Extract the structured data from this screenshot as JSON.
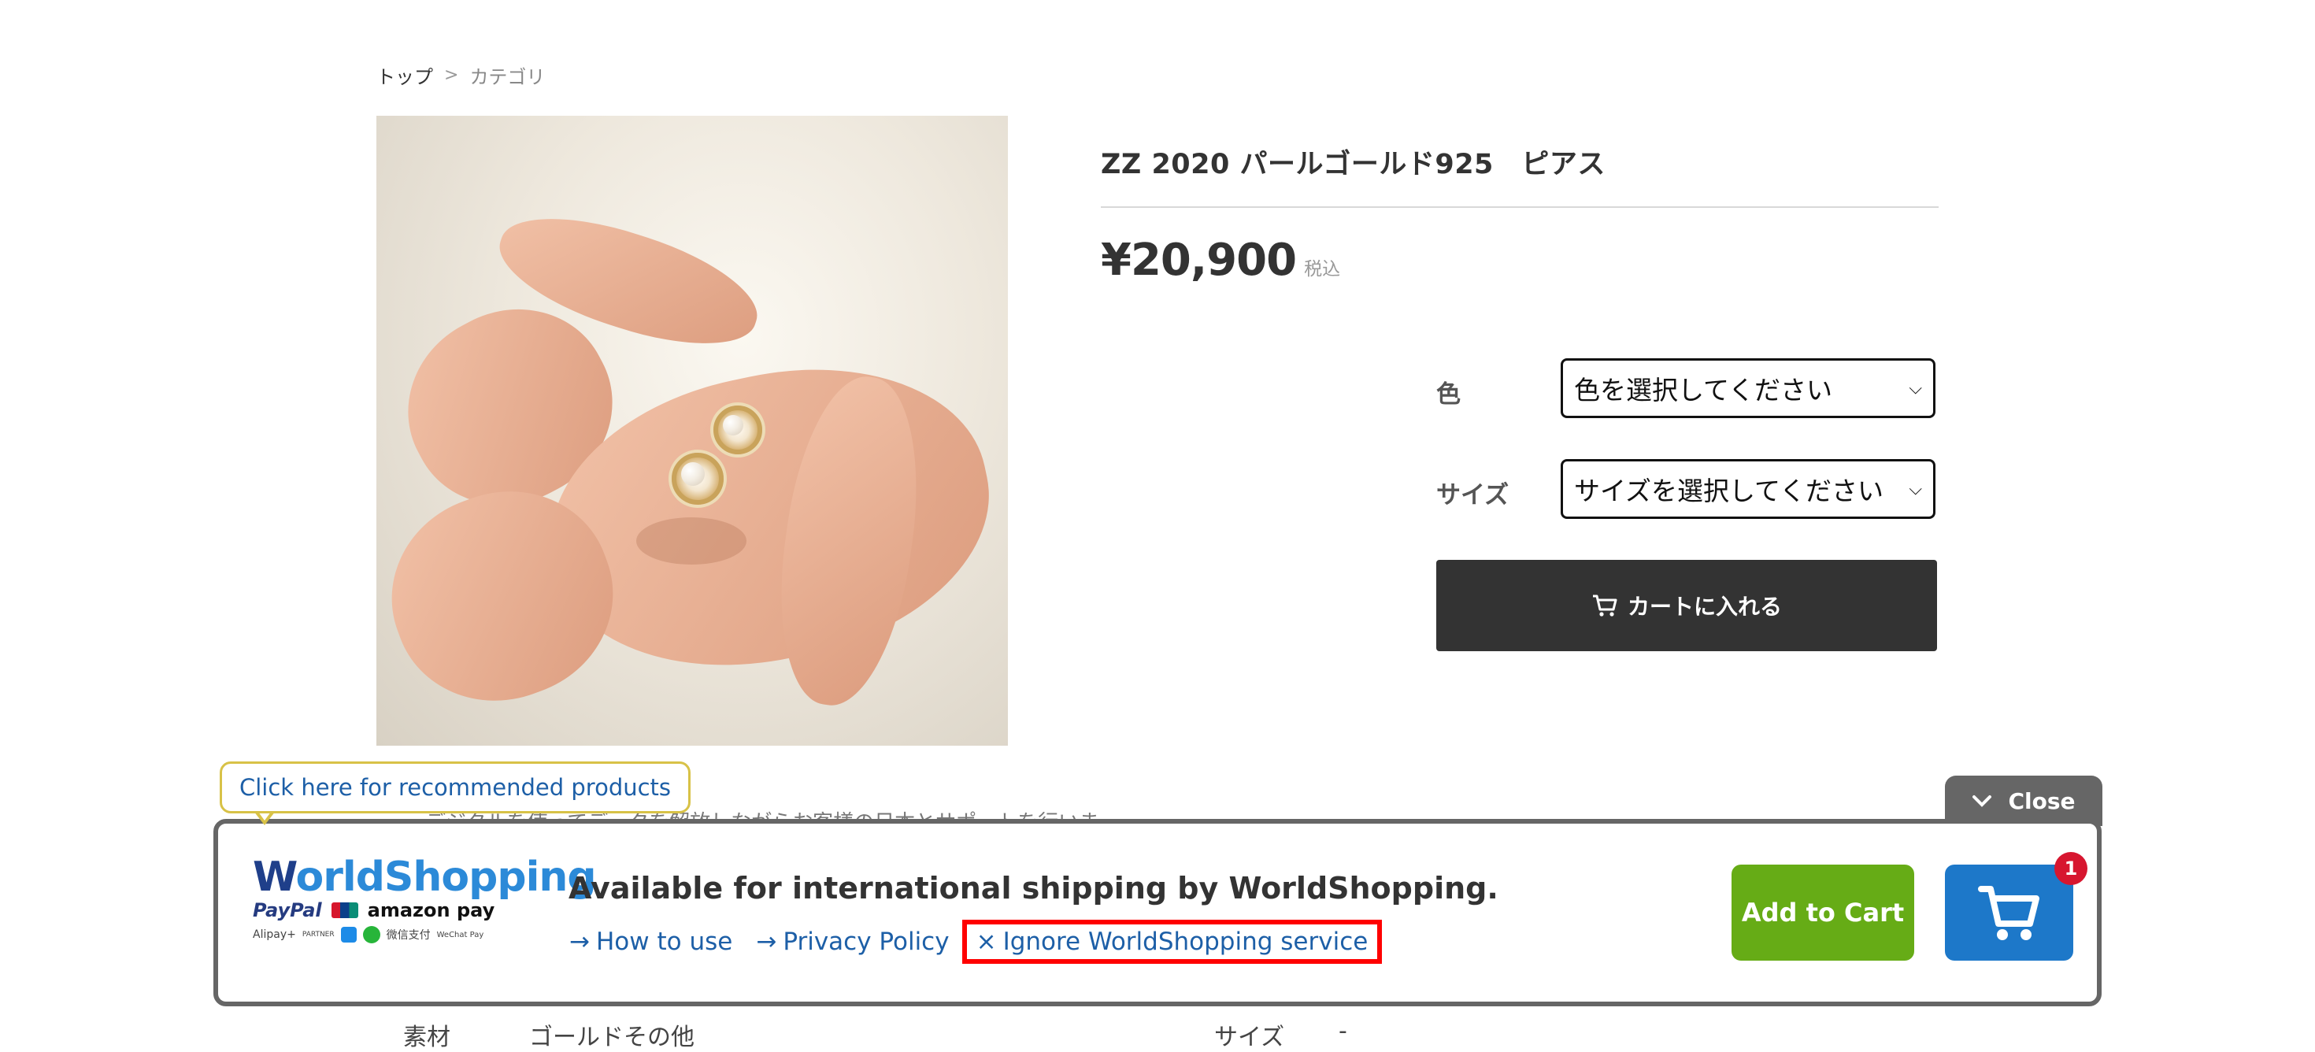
{
  "breadcrumb": {
    "home": "トップ",
    "separator": ">",
    "current": "カテゴリ"
  },
  "product": {
    "title": "ZZ 2020 パールゴールド925　ピアス",
    "price": "¥20,900",
    "tax_label": "税込",
    "image_alt": "hands holding pearl gold earrings"
  },
  "options": {
    "color_label": "色",
    "color_select": "色を選択してください",
    "size_label": "サイズ",
    "size_select": "サイズを選択してください"
  },
  "cart_button": {
    "label": "カートに入れる",
    "icon": "cart-icon"
  },
  "background_text": {
    "description_partial": "デジタルを使ってデータを解放しながらお客様の日本とサポートを行いま",
    "spec_material_label": "素材",
    "spec_material_value": "ゴールドその他",
    "spec_size_label": "サイズ",
    "spec_size_value": "-"
  },
  "worldshopping": {
    "logo_text_w": "W",
    "logo_text_rest": "orldShopping",
    "payment_row1": [
      "PayPal",
      "amazon pay"
    ],
    "payment_row2": [
      "Alipay+",
      "PARTNER",
      "微信支付",
      "WeChat Pay"
    ],
    "heading": "Available for international shipping by WorldShopping.",
    "links": {
      "how_to_use": "How to use",
      "privacy_policy": "Privacy Policy",
      "ignore": "Ignore WorldShopping service"
    },
    "add_to_cart": "Add to Cart",
    "cart_count": "1",
    "close_label": "Close",
    "tooltip": "Click here for recommended products"
  },
  "colors": {
    "cart_button_bg": "#333333",
    "ws_add_green": "#66ac16",
    "ws_cart_blue": "#1d78c9",
    "link_blue": "#1d5fa7",
    "highlight_red": "#ff0000"
  }
}
